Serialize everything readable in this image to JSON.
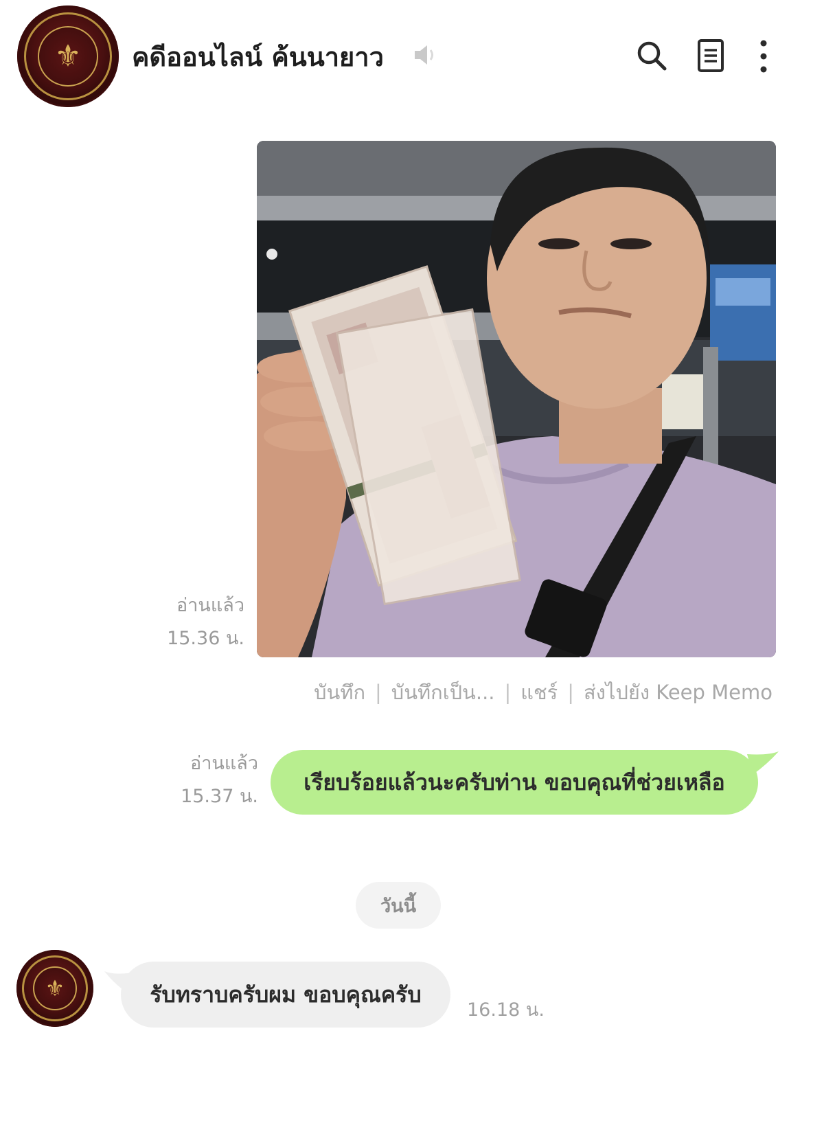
{
  "header": {
    "title": "คดีออนไลน์ ค้นนายาว",
    "icons": {
      "mute": "speaker-muted-icon",
      "search": "search-icon",
      "notes": "notes-icon",
      "more": "more-vertical-icon"
    }
  },
  "messages": {
    "photo": {
      "read_label": "อ่านแล้ว",
      "time": "15.36 น.",
      "actions": [
        "บันทึก",
        "บันทึกเป็น...",
        "แชร์",
        "ส่งไปยัง Keep Memo"
      ]
    },
    "sent_text": {
      "read_label": "อ่านแล้ว",
      "time": "15.37 น.",
      "text": "เรียบร้อยแล้วนะครับท่าน ขอบคุณที่ช่วยเหลือ"
    },
    "date_divider": "วันนี้",
    "received_text": {
      "text": "รับทราบครับผม ขอบคุณครับ",
      "time": "16.18 น."
    }
  },
  "colors": {
    "sent_bubble": "#b8ee8f",
    "received_bubble": "#efefef",
    "meta_text": "#9a9a9a",
    "avatar_maroon": "#4a1010",
    "avatar_gold": "#b99240"
  }
}
